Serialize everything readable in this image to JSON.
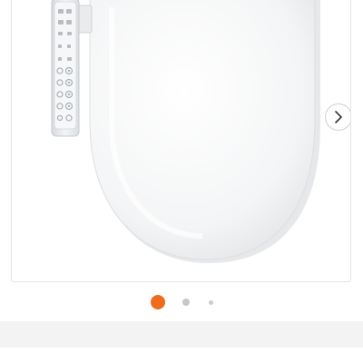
{
  "carousel": {
    "image_subject": "bidet-toilet-seat-with-side-control-panel",
    "slide_count": 3,
    "active_slide": 1,
    "next_icon": "chevron-right-icon",
    "colors": {
      "active_dot": "#ee6c1e",
      "inactive_dot": "#c8c8c8",
      "border": "#e3e3e3",
      "bottom_band": "#f3f3f3"
    }
  }
}
